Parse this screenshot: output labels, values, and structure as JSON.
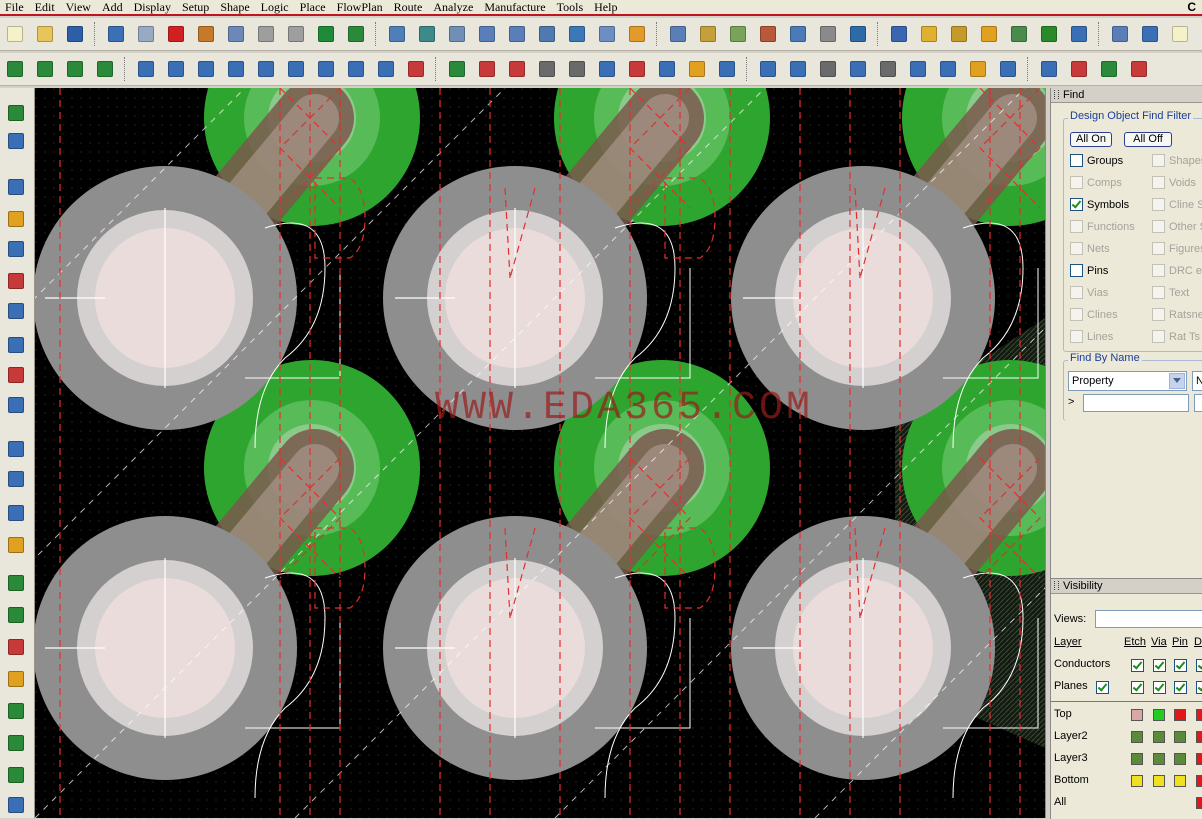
{
  "menu": [
    {
      "label": "File",
      "id": "file"
    },
    {
      "label": "Edit",
      "id": "edit"
    },
    {
      "label": "View",
      "id": "view"
    },
    {
      "label": "Add",
      "id": "add"
    },
    {
      "label": "Display",
      "id": "display"
    },
    {
      "label": "Setup",
      "id": "setup"
    },
    {
      "label": "Shape",
      "id": "shape"
    },
    {
      "label": "Logic",
      "id": "logic"
    },
    {
      "label": "Place",
      "id": "place"
    },
    {
      "label": "FlowPlan",
      "id": "flowplan"
    },
    {
      "label": "Route",
      "id": "route"
    },
    {
      "label": "Analyze",
      "id": "analyze"
    },
    {
      "label": "Manufacture",
      "id": "manufacture"
    },
    {
      "label": "Tools",
      "id": "tools"
    },
    {
      "label": "Help",
      "id": "help"
    }
  ],
  "app_letter": "C",
  "toolbar1_icons": [
    "new-file-icon",
    "open-folder-icon",
    "save-icon",
    "|",
    "move-icon",
    "copy-icon",
    "delete-icon",
    "undo-icon",
    "redo-down-icon",
    "redo-icon",
    "redo-alt-icon",
    "shape-fill-icon",
    "pin-icon",
    "|",
    "grid-view-icon",
    "grid-toggle-icon",
    "zoom-fit-icon",
    "zoom-in-icon",
    "zoom-out-icon",
    "zoom-world-icon",
    "zoom-previous-icon",
    "zoom-window-icon",
    "refresh-icon",
    "|",
    "grid-icon",
    "color-icon",
    "layers-icon",
    "stackup-icon",
    "constraint-manager-icon",
    "spreadsheet-icon",
    "3d-view-icon",
    "|",
    "info-icon",
    "show-element-icon",
    "measure-icon",
    "highlight-icon",
    "dehighlight-icon",
    "bar-chart-icon",
    "timer-icon",
    "|",
    "window-icon",
    "mail-icon",
    "help-icon"
  ],
  "toolbar2_icons": [
    "route-mode-icon",
    "slide-icon",
    "delay-tune-icon",
    "custom-smooth-icon",
    "|",
    "add-line-icon",
    "add-rect-icon",
    "add-circle-icon",
    "select-icon",
    "frame-icon",
    "rotate-icon",
    "square-icon",
    "circle-outline-icon",
    "plane-icon",
    "place-icon",
    "|",
    "dimension-icon",
    "dim-vertical-icon",
    "dim-linear-icon",
    "dim-datum-icon",
    "angle-icon",
    "line-icon",
    "drill-icon",
    "cut-icon",
    "coin-icon",
    "angle-measure-icon",
    "|",
    "odb-icon",
    "split-icon",
    "wrench-icon",
    "camera-icon",
    "refdes-icon",
    "flag-icon",
    "dots-icon",
    "stamp-icon",
    "matrix-icon",
    "|",
    "book-icon",
    "book-alt-icon",
    "check-icon",
    "edit-icon"
  ],
  "toolbar1_colors": [
    "#f5f1c9",
    "#e8c55a",
    "#2d5fa8",
    "#3b6fb6",
    "#9aa9c2",
    "#d22020",
    "#c57a2a",
    "#6b88b8",
    "#9e9e9e",
    "#9e9e9e",
    "#1f8a3a",
    "#2a8a3a",
    "#4f7fb8",
    "#3c8a8a",
    "#6f8fb6",
    "#5a7fb8",
    "#5a7fb8",
    "#4f7ab0",
    "#3a78b8",
    "#6b8fc2",
    "#e29a2a",
    "#5a7fb8",
    "#c5a03a",
    "#7aa35a",
    "#b85a3a",
    "#4a7ab8",
    "#8a8a8a",
    "#2d6aa8",
    "#3a66b0",
    "#e0b030",
    "#c59a2a",
    "#e0a020",
    "#4a8a4a",
    "#2a8a2a",
    "#3a6fb6",
    "#5a7fb8",
    "#3a6fb6"
  ],
  "toolbar2_colors": [
    "#2a8a3a",
    "#2a8a3a",
    "#2a8a3a",
    "#2a8a3a",
    "#3a6fb6",
    "#3a6fb6",
    "#3a6fb6",
    "#3a6fb6",
    "#3a6fb6",
    "#3a6fb6",
    "#3a6fb6",
    "#3a6fb6",
    "#3a6fb6",
    "#c83a3a",
    "#2a8a3a",
    "#c83a3a",
    "#c83a3a",
    "#6a6a6a",
    "#6a6a6a",
    "#3a6fb6",
    "#c83a3a",
    "#3a6fb6",
    "#e0a020",
    "#3a6fb6",
    "#3a6fb6",
    "#3a6fb6",
    "#6a6a6a",
    "#3a6fb6",
    "#6a6a6a",
    "#3a6fb6",
    "#3a6fb6",
    "#e0a020",
    "#3a6fb6",
    "#3a6fb6",
    "#c83a3a",
    "#2a8a3a",
    "#c83a3a"
  ],
  "left_icons": [
    {
      "name": "place-component-icon",
      "color": "#2a8a3a"
    },
    {
      "name": "ratsnest-icon",
      "color": "#3a6fb6"
    },
    {
      "name": "add-connect-icon",
      "color": "#3a6fb6"
    },
    {
      "name": "slide-icon",
      "color": "#e0a020"
    },
    {
      "name": "delay-tune-icon",
      "color": "#3a6fb6"
    },
    {
      "name": "custom-smooth-icon",
      "color": "#c83a3a"
    },
    {
      "name": "vertex-icon",
      "color": "#3a6fb6"
    },
    {
      "name": "cline-icon",
      "color": "#3a6fb6"
    },
    {
      "name": "spread-icon",
      "color": "#c83a3a"
    },
    {
      "name": "bus-icon",
      "color": "#3a6fb6"
    },
    {
      "name": "add-line-icon",
      "color": "#3a6fb6"
    },
    {
      "name": "add-rect-icon",
      "color": "#3a6fb6"
    },
    {
      "name": "add-text-icon",
      "color": "#3a6fb6"
    },
    {
      "name": "edit-text-icon",
      "color": "#e0a020"
    },
    {
      "name": "route-icon",
      "color": "#2a8a3a"
    },
    {
      "name": "connect-icon",
      "color": "#2a8a3a"
    },
    {
      "name": "delete-route-icon",
      "color": "#c83a3a"
    },
    {
      "name": "fanout-icon",
      "color": "#e0a020"
    },
    {
      "name": "group-route-icon",
      "color": "#2a8a3a"
    },
    {
      "name": "route-via-icon",
      "color": "#2a8a3a"
    },
    {
      "name": "tune-icon",
      "color": "#2a8a3a"
    },
    {
      "name": "auto-route-icon",
      "color": "#3a6fb6"
    }
  ],
  "canvas": {
    "watermark": "WWW.EDA365.COM"
  },
  "find_panel": {
    "title": "Find",
    "filter_title": "Design Object Find Filter",
    "all_on": "All On",
    "all_off": "All Off",
    "checkboxes": [
      {
        "label": "Groups",
        "checked": false,
        "enabled": true
      },
      {
        "label": "Shapes",
        "checked": false,
        "enabled": false
      },
      {
        "label": "Comps",
        "checked": false,
        "enabled": false
      },
      {
        "label": "Voids",
        "checked": false,
        "enabled": false
      },
      {
        "label": "Symbols",
        "checked": true,
        "enabled": true
      },
      {
        "label": "Cline Se",
        "checked": false,
        "enabled": false
      },
      {
        "label": "Functions",
        "checked": false,
        "enabled": false
      },
      {
        "label": "Other S",
        "checked": false,
        "enabled": false
      },
      {
        "label": "Nets",
        "checked": false,
        "enabled": false
      },
      {
        "label": "Figures",
        "checked": false,
        "enabled": false
      },
      {
        "label": "Pins",
        "checked": false,
        "enabled": true
      },
      {
        "label": "DRC er",
        "checked": false,
        "enabled": false
      },
      {
        "label": "Vias",
        "checked": false,
        "enabled": false
      },
      {
        "label": "Text",
        "checked": false,
        "enabled": false
      },
      {
        "label": "Clines",
        "checked": false,
        "enabled": false
      },
      {
        "label": "Ratsne",
        "checked": false,
        "enabled": false
      },
      {
        "label": "Lines",
        "checked": false,
        "enabled": false
      },
      {
        "label": "Rat Ts",
        "checked": false,
        "enabled": false
      }
    ],
    "find_by_name_title": "Find By Name",
    "property_select": "Property",
    "name_select": "N",
    "arrow": ">",
    "name_input": ""
  },
  "visibility_panel": {
    "title": "Visibility",
    "views_label": "Views:",
    "views_value": "",
    "headers": {
      "layer": "Layer",
      "etch": "Etch",
      "via": "Via",
      "pin": "Pin",
      "drc": "D"
    },
    "rows": [
      {
        "label": "Conductors",
        "swatches": [
          "#ffffff",
          "#ffffff",
          "#ffffff",
          "#ffffff"
        ]
      },
      {
        "label": "Planes",
        "swatches": [
          "#ffffff",
          "#ffffff",
          "#ffffff",
          "#ffffff"
        ]
      }
    ],
    "layers": [
      {
        "label": "Top",
        "colors": [
          "#d8a8a8",
          "#22cc22",
          "#e01818",
          "#e01818"
        ]
      },
      {
        "label": "Layer2",
        "colors": [
          "#5a8a3a",
          "#5a8a3a",
          "#5a8a3a",
          "#e01818"
        ]
      },
      {
        "label": "Layer3",
        "colors": [
          "#5a8a3a",
          "#5a8a3a",
          "#5a8a3a",
          "#e01818"
        ]
      },
      {
        "label": "Bottom",
        "colors": [
          "#f0e020",
          "#f0e020",
          "#f0e020",
          "#e01818"
        ]
      },
      {
        "label": "All",
        "colors": [
          null,
          null,
          null,
          "#e01818"
        ]
      }
    ]
  }
}
